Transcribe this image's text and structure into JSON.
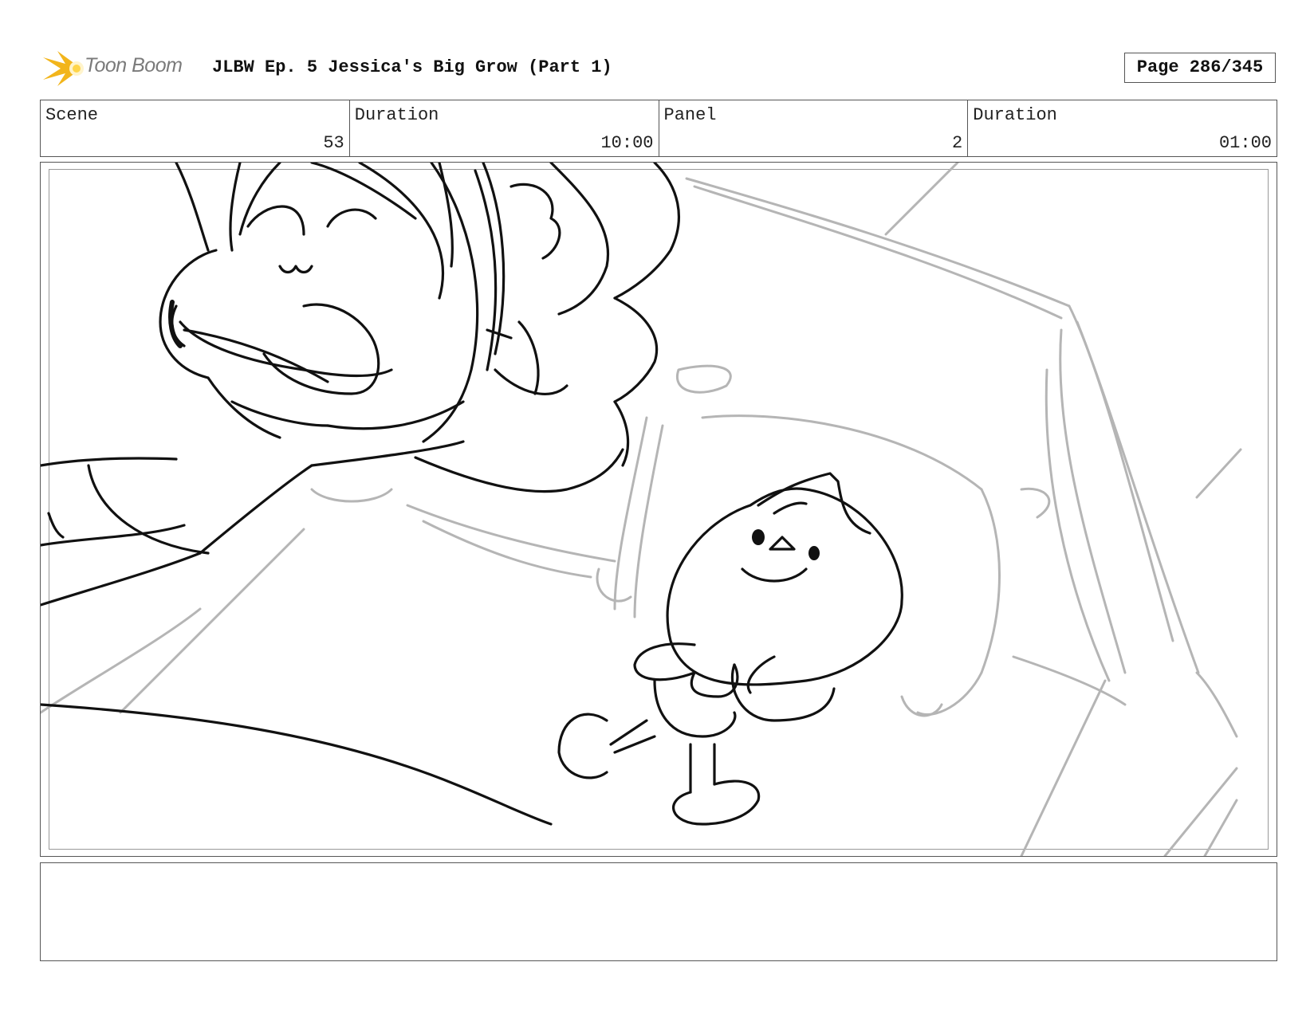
{
  "header": {
    "logo_text": "Toon Boom",
    "title": "JLBW Ep. 5 Jessica's Big Grow (Part 1)",
    "page": "Page 286/345"
  },
  "info": {
    "scene_label": "Scene",
    "scene_value": "53",
    "scene_duration_label": "Duration",
    "scene_duration_value": "10:00",
    "panel_label": "Panel",
    "panel_value": "2",
    "panel_duration_label": "Duration",
    "panel_duration_value": "01:00"
  },
  "notes": {
    "text": ""
  },
  "colors": {
    "logo_accent": "#f2b51c",
    "sketch_ink": "#111111",
    "sketch_rough": "#b0b0b0"
  },
  "icons": {
    "logo": "toon-boom-burst-icon"
  }
}
